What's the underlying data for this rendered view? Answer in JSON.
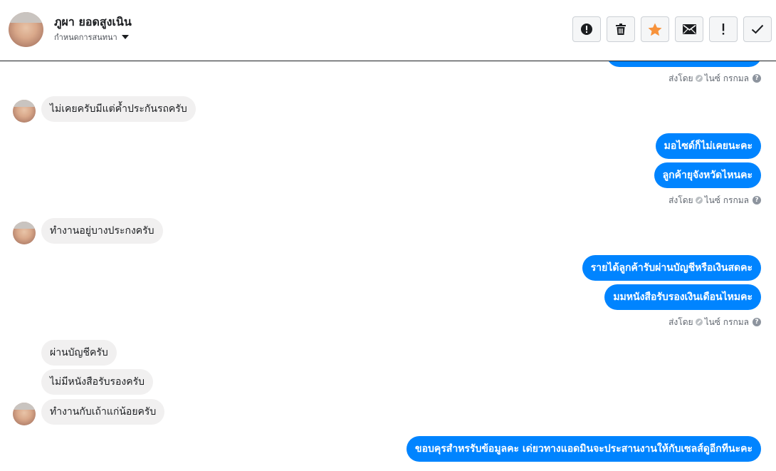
{
  "header": {
    "contact_name": "ภูผา ยอดสูงเนิน",
    "assign_label": "กำหนดการสนทนา",
    "actions": [
      {
        "name": "report-spam-button",
        "icon": "alert-circle-icon"
      },
      {
        "name": "delete-button",
        "icon": "trash-icon"
      },
      {
        "name": "star-button",
        "icon": "star-icon"
      },
      {
        "name": "mark-unread-button",
        "icon": "envelope-icon"
      },
      {
        "name": "follow-up-button",
        "icon": "exclamation-icon"
      },
      {
        "name": "mark-done-button",
        "icon": "check-icon"
      }
    ],
    "star_color": "#f7923b"
  },
  "sent_by": {
    "label": "ส่งโดย",
    "agent": "ไนซ์ กรกมล",
    "help": "?"
  },
  "messages": {
    "m1": "ไม่เคยครับมีแต่ค้ำประกันรถครับ",
    "m2": "มอไซด์ก็ไม่เคยนะคะ",
    "m3": "ลูกค้ายุจังหวัดไหนคะ",
    "m4": "ทำงานอยู่บางประกงครับ",
    "m5": "รายได้ลูกค้ารับผ่านบัญชีหรือเงินสดคะ",
    "m6": "มมหนังสือรับรองเงินเดือนไหมคะ",
    "m7": "ผ่านบัญชีครับ",
    "m8": "ไม่มีหนังสือรับรองครับ",
    "m9": "ทำงานกับเถ้าแก่น้อยครับ",
    "m10": "ขอบคุรสำหรรับข้อมูลคะ เด่ยวทางแอดมินจะประสานงานให้กับเซลส์ดูอีกทีนะคะ"
  },
  "colors": {
    "outgoing_bubble": "#0084ff",
    "incoming_bubble": "#f1f0f0"
  }
}
